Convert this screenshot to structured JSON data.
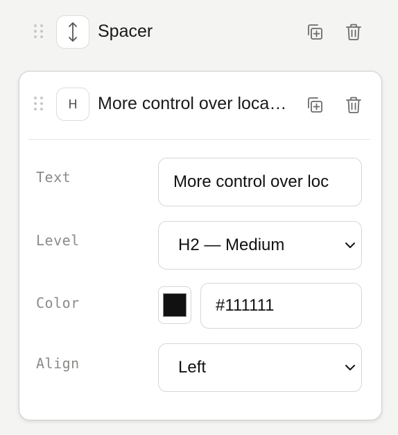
{
  "spacer_block": {
    "title": "Spacer",
    "type_icon": "vertical-resize-icon"
  },
  "heading_block": {
    "title": "More control over loca…",
    "type_badge": "H",
    "fields": {
      "text": {
        "label": "Text",
        "value": "More control over loc"
      },
      "level": {
        "label": "Level",
        "value": "H2 — Medium"
      },
      "color": {
        "label": "Color",
        "value": "#111111",
        "swatch": "#111111"
      },
      "align": {
        "label": "Align",
        "value": "Left"
      }
    }
  },
  "icons": {
    "duplicate": "duplicate-icon",
    "delete": "trash-icon",
    "drag": "drag-handle-icon",
    "dropdown": "chevron-down-icon"
  },
  "colors": {
    "background": "#f4f4f3",
    "card": "#ffffff",
    "icon_stroke": "#6b6b6b",
    "label": "#8a8a88"
  }
}
